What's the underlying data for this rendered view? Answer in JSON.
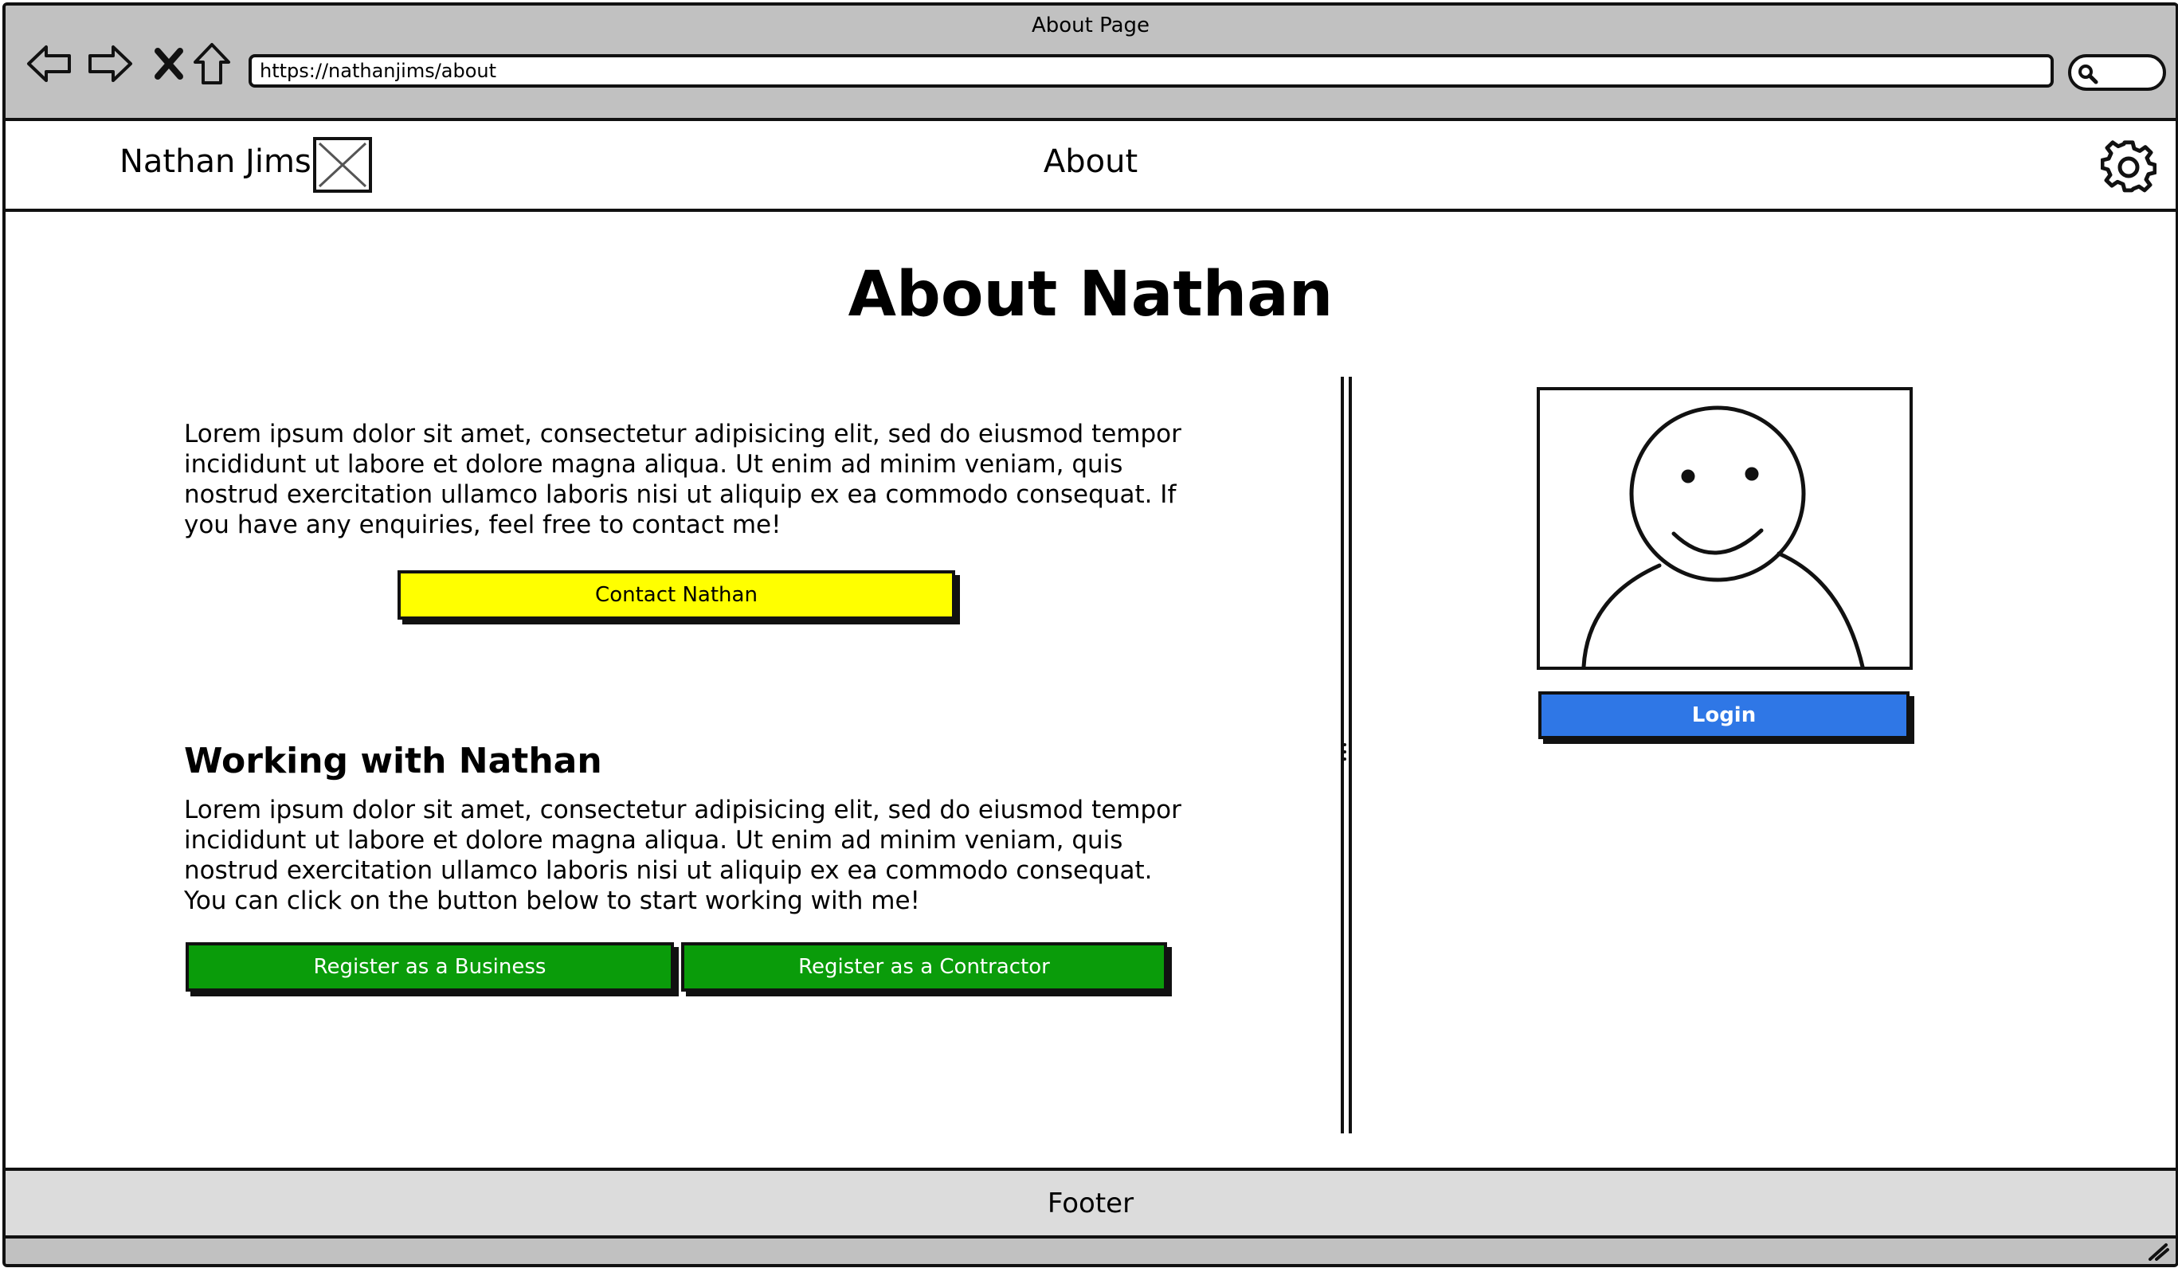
{
  "browser": {
    "window_title": "About Page",
    "url": "https://nathanjims/about",
    "icons": [
      "back-arrow-icon",
      "forward-arrow-icon",
      "close-icon",
      "home-icon",
      "search-icon"
    ]
  },
  "header": {
    "brand_name": "Nathan Jims",
    "brand_logo": "image-placeholder-icon",
    "nav_title": "About",
    "settings_icon": "gear-icon"
  },
  "main": {
    "title": "About Nathan",
    "intro_text": "Lorem ipsum dolor sit amet, consectetur adipisicing elit, sed do eiusmod tempor incididunt ut labore et dolore magna aliqua. Ut enim ad minim veniam, quis nostrud exercitation ullamco laboris nisi ut aliquip ex ea commodo consequat. If you have any enquiries, feel free to contact me!",
    "contact_button": "Contact Nathan",
    "working_heading": "Working with Nathan",
    "working_text": "Lorem ipsum dolor sit amet, consectetur adipisicing elit, sed do eiusmod tempor incididunt ut labore et dolore magna aliqua. Ut enim ad minim veniam, quis nostrud exercitation ullamco laboris nisi ut aliquip ex ea commodo consequat. You can click on the button below to start working with me!",
    "register_business_button": "Register as a Business",
    "register_contractor_button": "Register as a Contractor"
  },
  "profile": {
    "image": "person-avatar-icon",
    "login_button": "Login"
  },
  "footer": {
    "label": "Footer"
  },
  "colors": {
    "chrome": "#c1c1c1",
    "contact_button": "#ffff00",
    "register_buttons": "#0a9c0a",
    "login_button": "#2f77e6",
    "footer": "#dcdcdc"
  }
}
